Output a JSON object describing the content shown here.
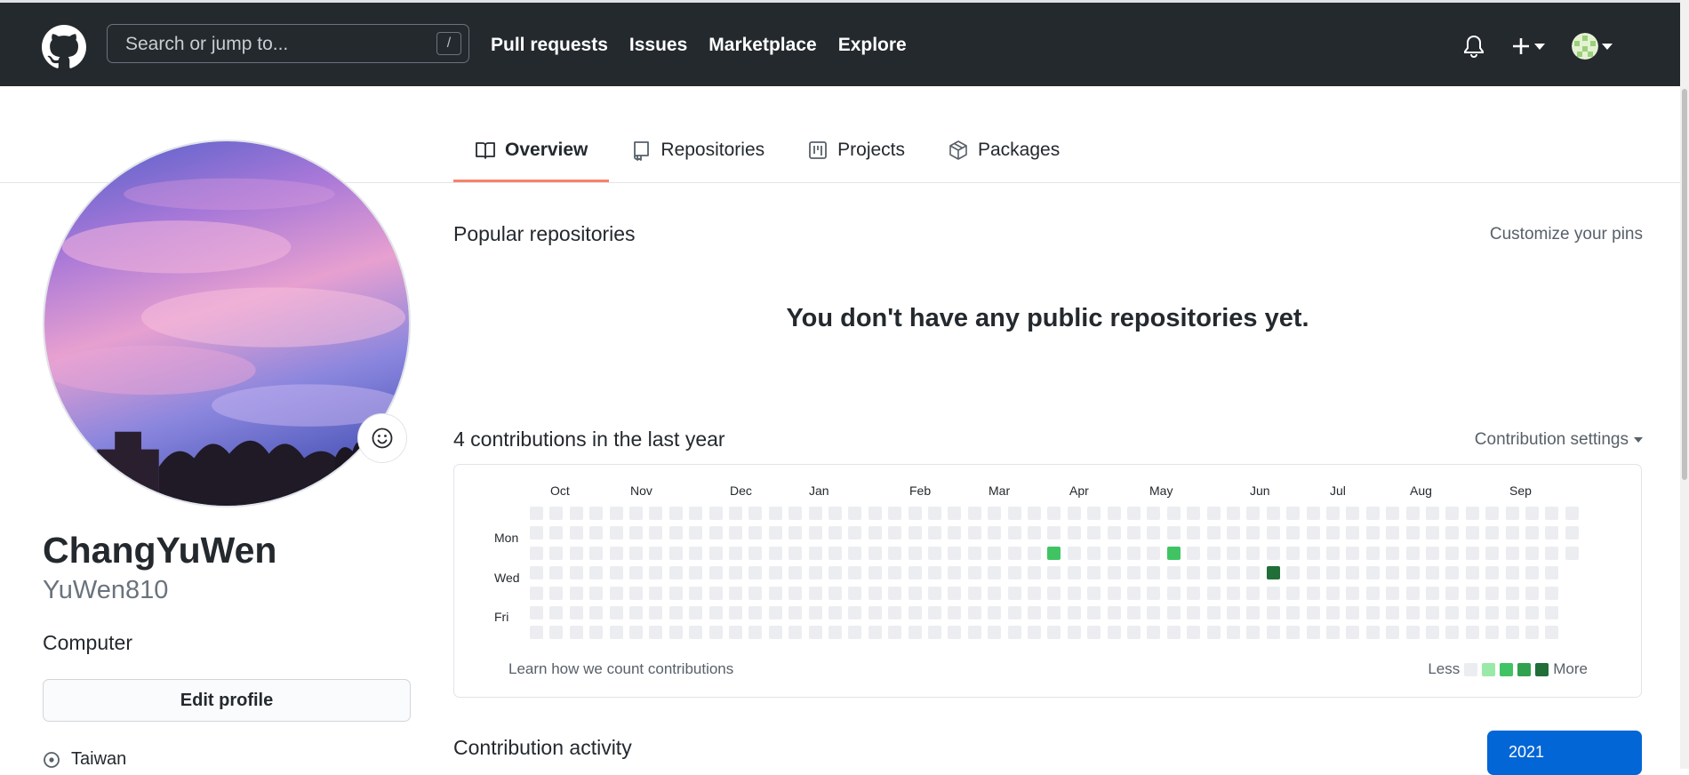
{
  "header": {
    "search_placeholder": "Search or jump to...",
    "search_shortcut": "/",
    "nav": [
      "Pull requests",
      "Issues",
      "Marketplace",
      "Explore"
    ]
  },
  "tabs": [
    {
      "label": "Overview",
      "icon": "book-icon",
      "active": true
    },
    {
      "label": "Repositories",
      "icon": "repo-icon",
      "active": false
    },
    {
      "label": "Projects",
      "icon": "project-icon",
      "active": false
    },
    {
      "label": "Packages",
      "icon": "package-icon",
      "active": false
    }
  ],
  "profile": {
    "full_name": "ChangYuWen",
    "username": "YuWen810",
    "bio": "Computer",
    "edit_button": "Edit profile",
    "location": "Taiwan"
  },
  "popular": {
    "title": "Popular repositories",
    "customize": "Customize your pins",
    "empty_message": "You don't have any public repositories yet."
  },
  "contributions": {
    "title": "4 contributions in the last year",
    "settings": "Contribution settings",
    "months": [
      "Oct",
      "Nov",
      "Dec",
      "Jan",
      "Feb",
      "Mar",
      "Apr",
      "May",
      "Jun",
      "Jul",
      "Aug",
      "Sep"
    ],
    "day_labels": [
      "Mon",
      "Wed",
      "Fri"
    ],
    "learn_link": "Learn how we count contributions",
    "legend_less": "Less",
    "legend_more": "More",
    "colors": [
      "#ebedf0",
      "#9be9a8",
      "#40c463",
      "#30a14e",
      "#216e39"
    ],
    "week_count": 53,
    "active_days": [
      {
        "week": 26,
        "weekday": 2,
        "level": 2
      },
      {
        "week": 32,
        "weekday": 2,
        "level": 2
      },
      {
        "week": 37,
        "weekday": 3,
        "level": 4
      }
    ]
  },
  "activity": {
    "title": "Contribution activity",
    "year": "2021"
  }
}
